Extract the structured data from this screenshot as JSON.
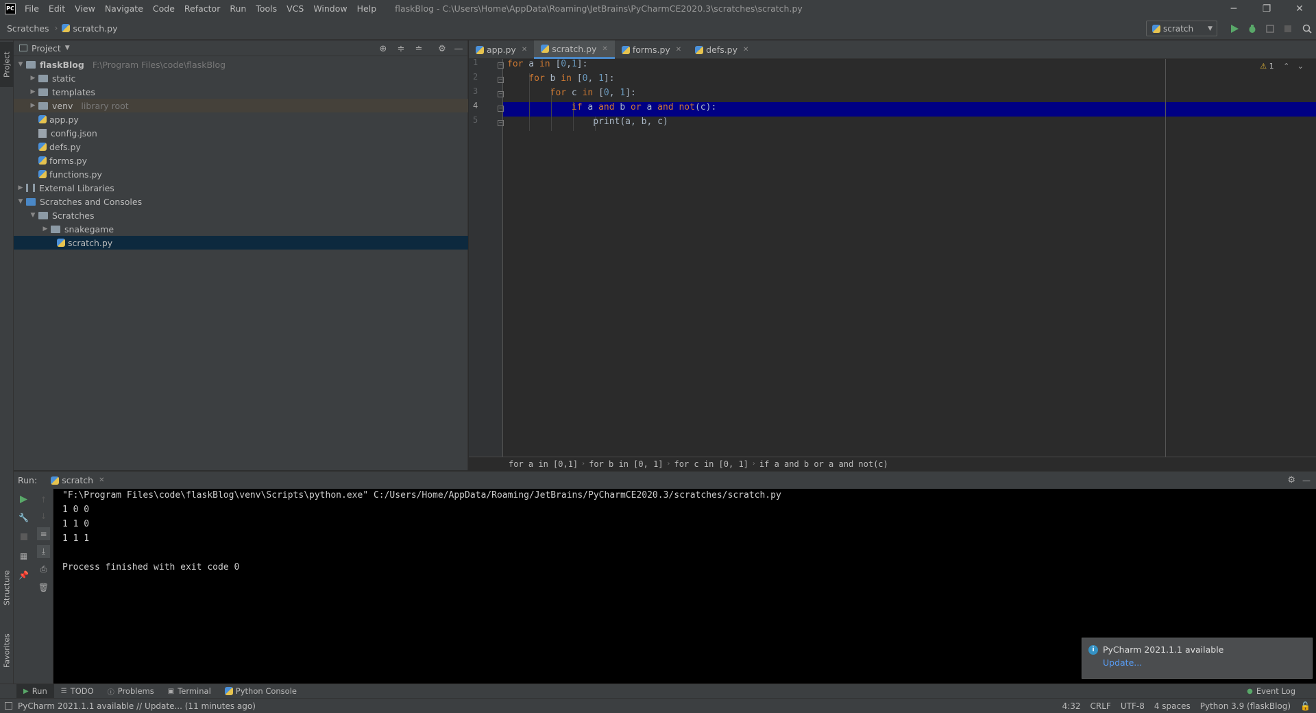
{
  "menu": {
    "items": [
      "File",
      "Edit",
      "View",
      "Navigate",
      "Code",
      "Refactor",
      "Run",
      "Tools",
      "VCS",
      "Window",
      "Help"
    ],
    "title": "flaskBlog - C:\\Users\\Home\\AppData\\Roaming\\JetBrains\\PyCharmCE2020.3\\scratches\\scratch.py",
    "logo": "PC"
  },
  "navbar": {
    "crumbs": [
      "Scratches",
      "scratch.py"
    ],
    "run_config": "scratch"
  },
  "left_strip": {
    "project": "Project",
    "structure": "Structure",
    "favorites": "Favorites"
  },
  "project": {
    "title": "Project",
    "tree": [
      {
        "label": "flaskBlog",
        "hint": "F:\\Program Files\\code\\flaskBlog",
        "type": "folder",
        "level": 0,
        "expanded": true
      },
      {
        "label": "static",
        "type": "folder",
        "level": 1,
        "expanded": false
      },
      {
        "label": "templates",
        "type": "folder",
        "level": 1,
        "expanded": false
      },
      {
        "label": "venv",
        "hint": "library root",
        "type": "folder",
        "level": 1,
        "expanded": false
      },
      {
        "label": "app.py",
        "type": "py",
        "level": 1
      },
      {
        "label": "config.json",
        "type": "file",
        "level": 1
      },
      {
        "label": "defs.py",
        "type": "py",
        "level": 1
      },
      {
        "label": "forms.py",
        "type": "py",
        "level": 1
      },
      {
        "label": "functions.py",
        "type": "py",
        "level": 1
      },
      {
        "label": "External Libraries",
        "type": "lib",
        "level": 0,
        "expanded": false
      },
      {
        "label": "Scratches and Consoles",
        "type": "scratch",
        "level": 0,
        "expanded": true
      },
      {
        "label": "Scratches",
        "type": "folder",
        "level": 1,
        "expanded": true
      },
      {
        "label": "snakegame",
        "type": "folder",
        "level": 2,
        "expanded": false
      },
      {
        "label": "scratch.py",
        "type": "py",
        "level": 2
      }
    ]
  },
  "editor": {
    "tabs": [
      "app.py",
      "scratch.py",
      "forms.py",
      "defs.py"
    ],
    "active_tab": "scratch.py",
    "line_numbers": [
      "1",
      "2",
      "3",
      "4",
      "5"
    ],
    "lines": [
      [
        {
          "t": "for",
          "c": "kw"
        },
        {
          "t": " a "
        },
        {
          "t": "in",
          "c": "kw"
        },
        {
          "t": " ["
        },
        {
          "t": "0",
          "c": "num"
        },
        {
          "t": ","
        },
        {
          "t": "1",
          "c": "num"
        },
        {
          "t": "]:"
        }
      ],
      [
        {
          "t": "    "
        },
        {
          "t": "for",
          "c": "kw"
        },
        {
          "t": " b "
        },
        {
          "t": "in",
          "c": "kw"
        },
        {
          "t": " ["
        },
        {
          "t": "0",
          "c": "num"
        },
        {
          "t": ", "
        },
        {
          "t": "1",
          "c": "num"
        },
        {
          "t": "]:"
        }
      ],
      [
        {
          "t": "        "
        },
        {
          "t": "for",
          "c": "kw"
        },
        {
          "t": " c "
        },
        {
          "t": "in",
          "c": "kw"
        },
        {
          "t": " ["
        },
        {
          "t": "0",
          "c": "num"
        },
        {
          "t": ", "
        },
        {
          "t": "1",
          "c": "num"
        },
        {
          "t": "]:"
        }
      ],
      [
        {
          "t": "            "
        },
        {
          "t": "if",
          "c": "kw"
        },
        {
          "t": " a "
        },
        {
          "t": "and",
          "c": "kw"
        },
        {
          "t": " b "
        },
        {
          "t": "or",
          "c": "kw"
        },
        {
          "t": " a "
        },
        {
          "t": "and",
          "c": "kw"
        },
        {
          "t": " "
        },
        {
          "t": "not",
          "c": "kw"
        },
        {
          "t": "(c):"
        }
      ],
      [
        {
          "t": "                print(a, b, c)"
        }
      ]
    ],
    "warnings": "1",
    "breadcrumbs": [
      "for a in [0,1]",
      "for b in [0, 1]",
      "for c in [0, 1]",
      "if a and b or a and not(c)"
    ]
  },
  "run": {
    "label": "Run:",
    "tab": "scratch",
    "output": [
      "\"F:\\Program Files\\code\\flaskBlog\\venv\\Scripts\\python.exe\" C:/Users/Home/AppData/Roaming/JetBrains/PyCharmCE2020.3/scratches/scratch.py",
      "1 0 0",
      "1 1 0",
      "1 1 1",
      "",
      "Process finished with exit code 0"
    ]
  },
  "notification": {
    "title": "PyCharm 2021.1.1 available",
    "link": "Update..."
  },
  "toolbar": {
    "run": "Run",
    "todo": "TODO",
    "problems": "Problems",
    "terminal": "Terminal",
    "python_console": "Python Console",
    "event_log": "Event Log"
  },
  "status": {
    "message": "PyCharm 2021.1.1 available // Update... (11 minutes ago)",
    "position": "4:32",
    "line_sep": "CRLF",
    "encoding": "UTF-8",
    "indent": "4 spaces",
    "interpreter": "Python 3.9 (flaskBlog)"
  },
  "colors": {
    "keyword": "#cc7832",
    "number": "#6897bb",
    "highlight_line": "#000084",
    "selection": "#0d293e"
  }
}
